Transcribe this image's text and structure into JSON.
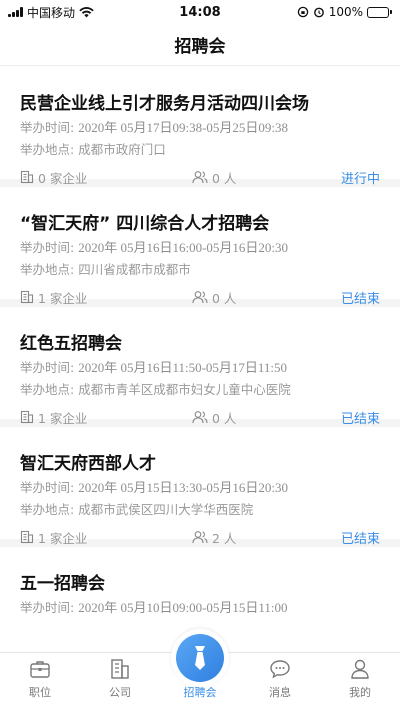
{
  "status_bar": {
    "carrier": "中国移动",
    "time": "14:08",
    "battery_text": "100%",
    "battery_level": 1.0,
    "battery_color": "#34c759"
  },
  "nav": {
    "title": "招聘会"
  },
  "labels": {
    "time_prefix": "举办时间:",
    "place_prefix": "举办地点:"
  },
  "fairs": [
    {
      "title": "民营企业线上引才服务月活动四川会场",
      "time": "2020年 05月17日09:38-05月25日09:38",
      "place": "成都市政府门口",
      "companies": "0 家企业",
      "people": "0 人",
      "status": "进行中"
    },
    {
      "title": "“智汇天府” 四川综合人才招聘会",
      "time": "2020年 05月16日16:00-05月16日20:30",
      "place": "四川省成都市成都市",
      "companies": "1 家企业",
      "people": "0 人",
      "status": "已结束"
    },
    {
      "title": "红色五招聘会",
      "time": "2020年 05月16日11:50-05月17日11:50",
      "place": "成都市青羊区成都市妇女儿童中心医院",
      "companies": "1 家企业",
      "people": "0 人",
      "status": "已结束"
    },
    {
      "title": "智汇天府西部人才",
      "time": "2020年 05月15日13:30-05月16日20:30",
      "place": "成都市武侯区四川大学华西医院",
      "companies": "1 家企业",
      "people": "2 人",
      "status": "已结束"
    },
    {
      "title": "五一招聘会",
      "time": "2020年 05月10日09:00-05月15日11:00"
    }
  ],
  "tabs": [
    {
      "label": "职位",
      "icon": "briefcase-icon"
    },
    {
      "label": "公司",
      "icon": "building-icon"
    },
    {
      "label": "招聘会",
      "icon": "tie-icon",
      "active": true
    },
    {
      "label": "消息",
      "icon": "chat-icon"
    },
    {
      "label": "我的",
      "icon": "person-icon"
    }
  ],
  "colors": {
    "accent": "#3a8ee6",
    "muted": "#9a9a9a"
  }
}
